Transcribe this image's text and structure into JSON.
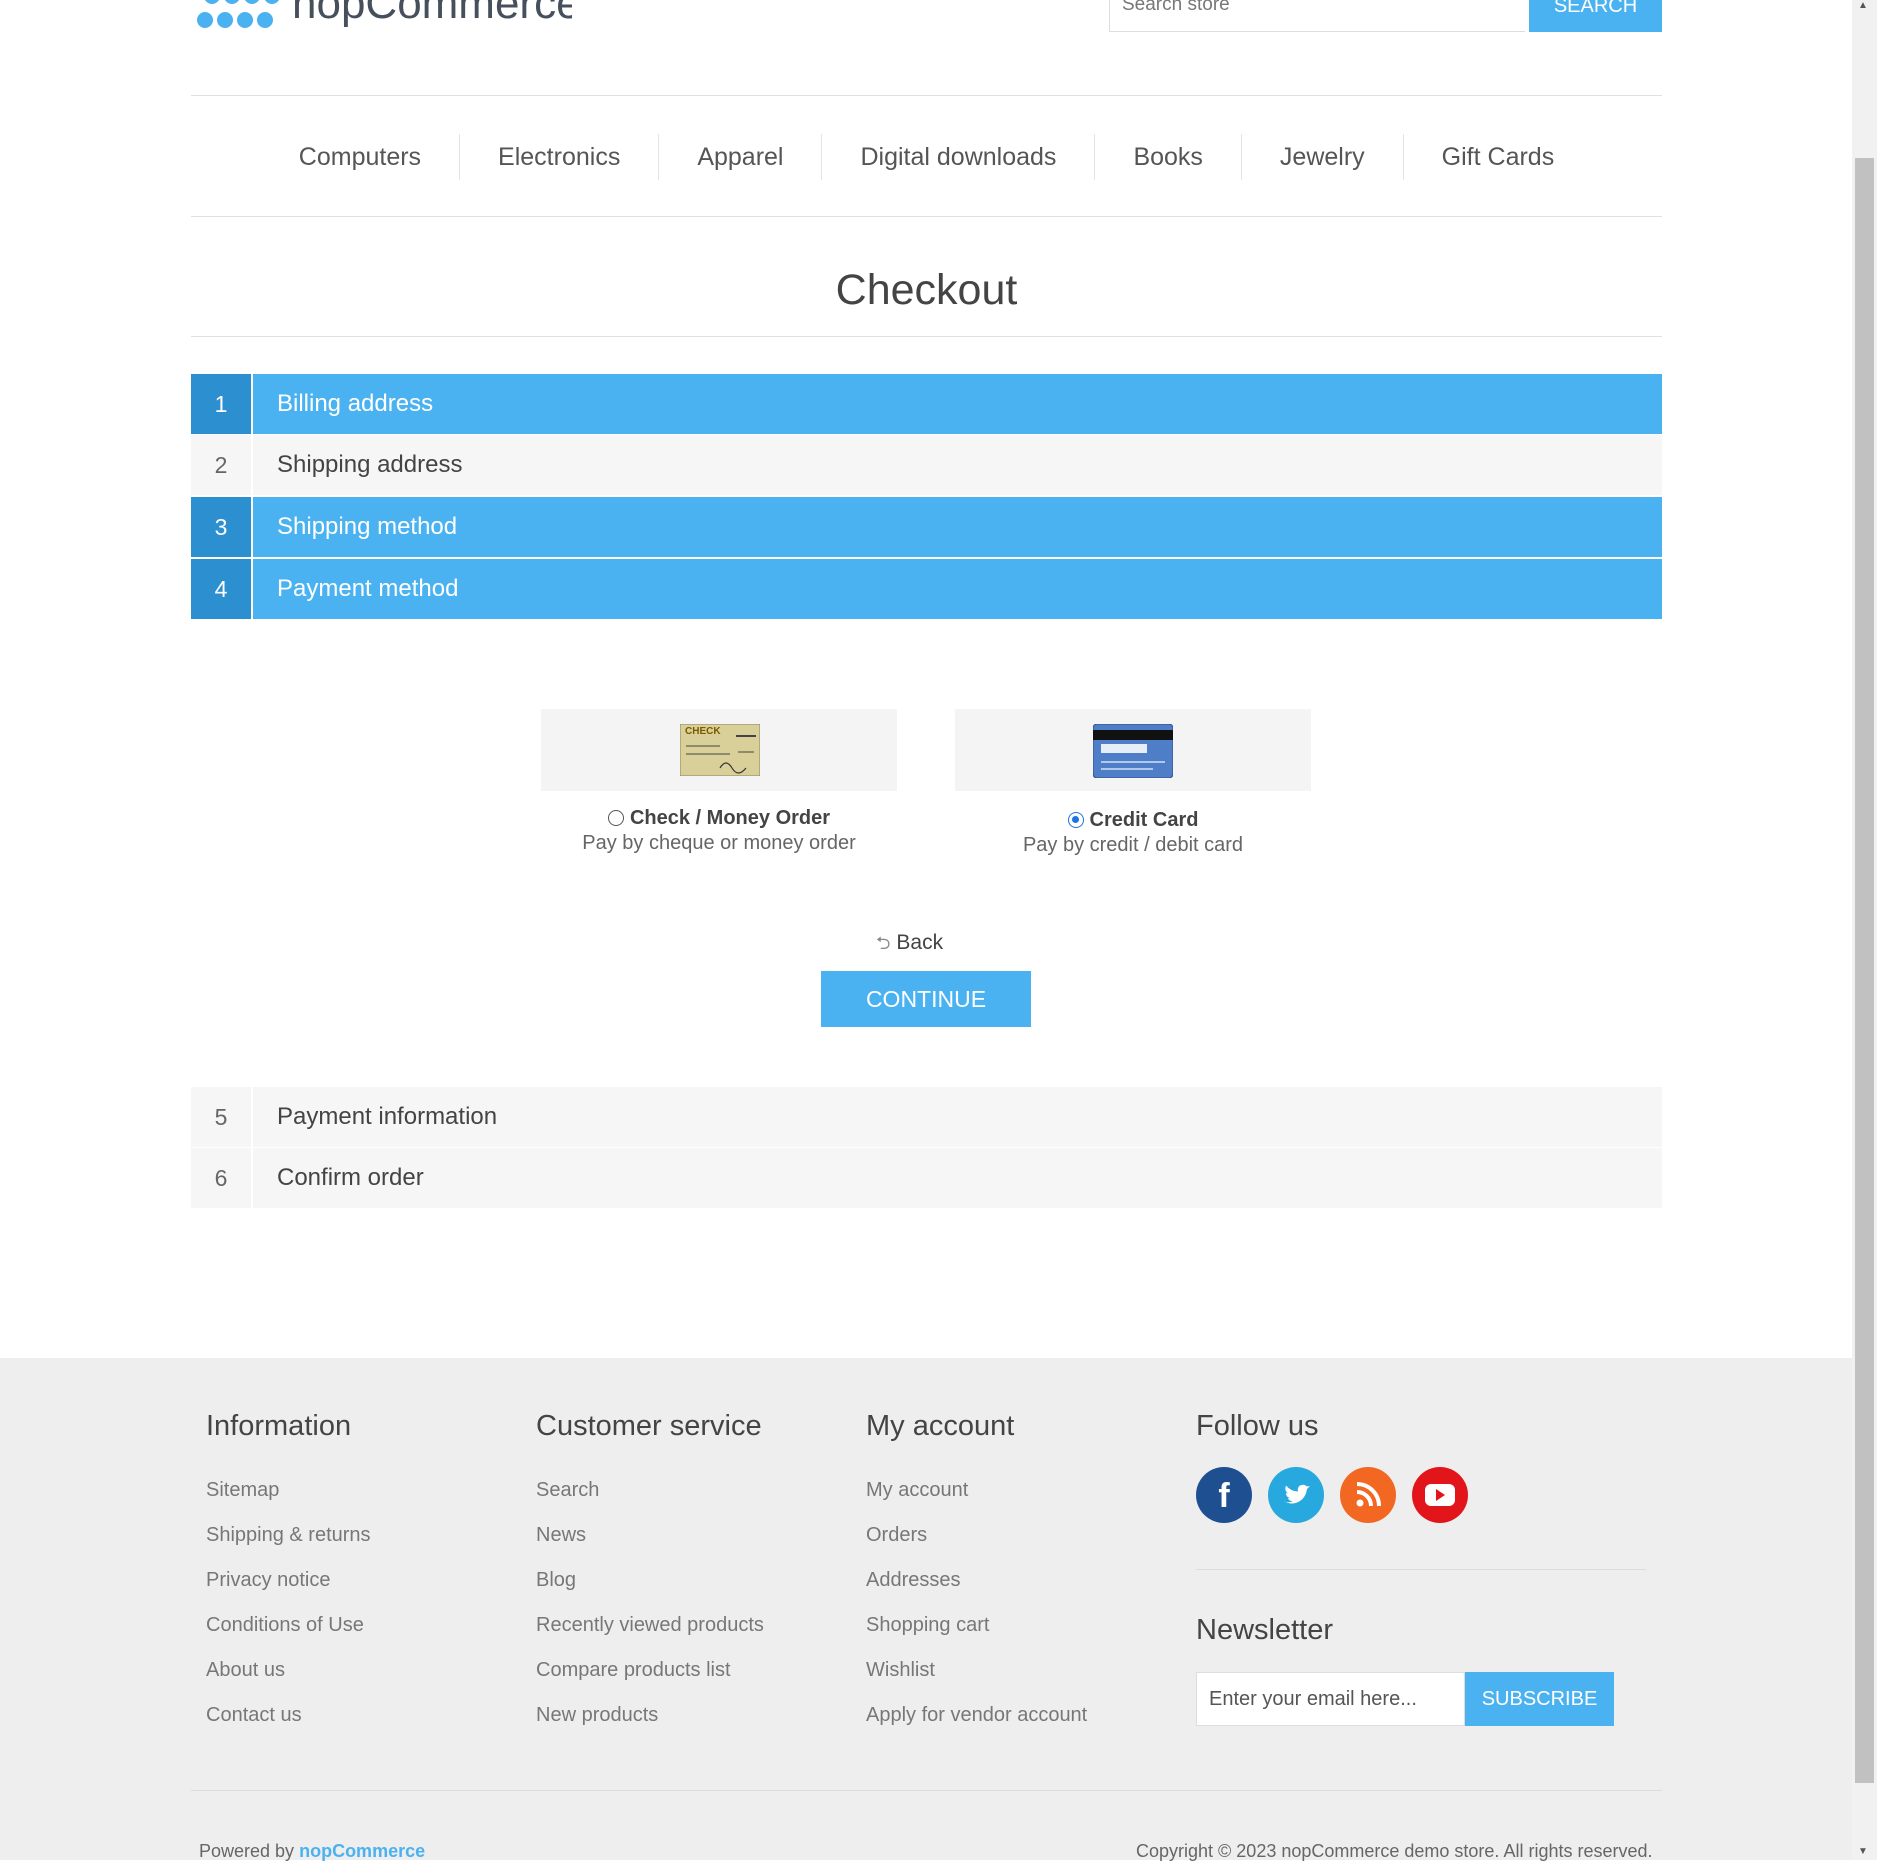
{
  "header": {
    "logo_text": "nopCommerce",
    "search_placeholder": "Search store",
    "search_button": "Search"
  },
  "menu": {
    "items": [
      "Computers",
      "Electronics",
      "Apparel",
      "Digital downloads",
      "Books",
      "Jewelry",
      "Gift Cards"
    ]
  },
  "page": {
    "title": "Checkout"
  },
  "steps": [
    {
      "num": "1",
      "title": "Billing address",
      "state": "active"
    },
    {
      "num": "2",
      "title": "Shipping address",
      "state": "inactive"
    },
    {
      "num": "3",
      "title": "Shipping method",
      "state": "active"
    },
    {
      "num": "4",
      "title": "Payment method",
      "state": "active"
    },
    {
      "num": "5",
      "title": "Payment information",
      "state": "inactive"
    },
    {
      "num": "6",
      "title": "Confirm order",
      "state": "inactive"
    }
  ],
  "payment_methods": [
    {
      "name": "Check / Money Order",
      "description": "Pay by cheque or money order",
      "selected": false,
      "image_text": "CHECK"
    },
    {
      "name": "Credit Card",
      "description": "Pay by credit / debit card",
      "selected": true
    }
  ],
  "actions": {
    "back_label": "Back",
    "continue_label": "Continue"
  },
  "footer": {
    "information": {
      "title": "Information",
      "links": [
        "Sitemap",
        "Shipping & returns",
        "Privacy notice",
        "Conditions of Use",
        "About us",
        "Contact us"
      ]
    },
    "customer_service": {
      "title": "Customer service",
      "links": [
        "Search",
        "News",
        "Blog",
        "Recently viewed products",
        "Compare products list",
        "New products"
      ]
    },
    "my_account": {
      "title": "My account",
      "links": [
        "My account",
        "Orders",
        "Addresses",
        "Shopping cart",
        "Wishlist",
        "Apply for vendor account"
      ]
    },
    "follow_us": {
      "title": "Follow us",
      "icons": [
        "facebook-icon",
        "twitter-icon",
        "rss-icon",
        "youtube-icon"
      ]
    },
    "newsletter": {
      "title": "Newsletter",
      "placeholder": "Enter your email here...",
      "button": "Subscribe"
    },
    "powered_by_prefix": "Powered by",
    "powered_by_brand": "nopCommerce",
    "copyright": "Copyright © 2023 nopCommerce demo store. All rights reserved."
  },
  "colors": {
    "accent": "#4ab2f1",
    "accent_dark": "#2c8fd0",
    "facebook": "#1d4f91",
    "twitter": "#27a8de",
    "rss": "#f26722",
    "youtube": "#e2151b"
  }
}
